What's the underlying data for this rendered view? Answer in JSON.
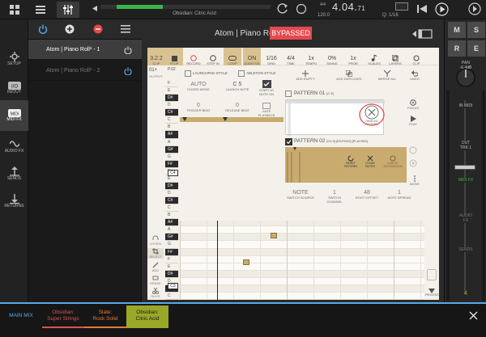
{
  "transport": {
    "track_name": "Obsidian: Citric Acid",
    "position": "4.04.",
    "position_ticks": "71",
    "time_sig": "4/4",
    "tempo": "120.0",
    "quantize": "Q: 1/16",
    "meter_level": 0.3
  },
  "sidebar": {
    "items": [
      {
        "label": "SETUP"
      },
      {
        "label": "IN/OUT"
      },
      {
        "label": "MIDI FX"
      },
      {
        "label": "AUDIO FX"
      },
      {
        "label": "SENDS"
      },
      {
        "label": "RETURNS"
      }
    ]
  },
  "fx": {
    "slots": [
      {
        "label": "Atom | Piano Roll² - 1"
      },
      {
        "label": "Atom | Piano Roll² - 2"
      }
    ]
  },
  "plugin": {
    "title": "Atom | Piano Roll²",
    "bypassed_label": "BYPASSED",
    "toolbar": {
      "clip_value": "3.2.2",
      "clip_label": "CLIP",
      "stop": "STOP",
      "record": "RECORD",
      "step_in": "STEP IN",
      "loop": "LOOP",
      "quantize_value": "ON",
      "quantize": "QUANTIZE",
      "grid_value": "1/16",
      "grid": "GRID",
      "timesig_value": "4/4",
      "timesig": "TIME",
      "tempo_value": "1x",
      "tempo": "TEMPO",
      "swing_value": "0%",
      "swing": "SWING",
      "prob_value": "1x",
      "prob": "PROB",
      "scales": "SCALES",
      "layers": "LAYERS",
      "clip": "CLIP"
    },
    "output_value": "01+",
    "output_label": "OUTPUT",
    "ruler_mark": "P.02",
    "launchpad_style": "LAUNCHPAD STYLE",
    "ableton_style": "ABLETON STYLE",
    "chord_mode_value": "AUTO",
    "chord_mode": "CHORD MODE",
    "launch_note_value": "C 5",
    "launch_note": "LAUNCH NOTE",
    "start_note_on": "START AT NOTE ON",
    "trigger_beat_value": "0",
    "trigger_beat": "TRIGGER BEAT",
    "release_beat_value": "0",
    "release_beat": "RELEASE BEAT",
    "gate_playback": "GATE PLAYBACK",
    "add_empty": "ADD EMPTY",
    "add_duplicate": "ADD DUPLICATE",
    "merge_all": "MERGE ALL",
    "undo": "UNDO",
    "pattern1": "PATTERN 01",
    "pattern1_note": "[C 5]",
    "pattern2": "PATTERN 02",
    "pattern2_note": "[C# 5] [EDITING] [PLAYING]",
    "remove_pattern": "REMOVE PATTERN",
    "reset_pattern": "RESET PATTERN",
    "clear_notes": "CLEAR NOTES",
    "cancel_automation": "CANCEL AUTOMATION",
    "focus": "FOCUS",
    "play": "PLAY",
    "move": "MOVE",
    "note_switch_value": "NOTE",
    "switch_source": "SWITCH SOURCE",
    "switch_channel_value": "1",
    "switch_channel": "SWITCH CHANNEL",
    "root_offset_value": "48",
    "root_offset": "ROOT OFFSET",
    "note_spread_value": "1",
    "note_spread": "NOTE SPREAD",
    "listen": "LISTEN",
    "select": "SELECT",
    "add": "ADD",
    "erase": "ERASE",
    "slice": "SLICE",
    "process": "PROCESS",
    "keys": [
      "F",
      "E",
      "D#",
      "D",
      "C#",
      "C",
      "B",
      "A#",
      "A",
      "G#",
      "G",
      "F#",
      "F",
      "E",
      "D#",
      "D",
      "C#",
      "C",
      "B",
      "A#",
      "A",
      "G#",
      "G",
      "F#",
      "F",
      "E",
      "D#",
      "D",
      "C#",
      "C"
    ],
    "key_tags": {
      "c4": "C4",
      "c3": "C3"
    }
  },
  "mixer": {
    "m": "M",
    "s": "S",
    "r": "R",
    "e": "E",
    "pan": "PAN",
    "db": "-6.4dB",
    "in_midi": "IN MIDI",
    "out_trk": "OUT TRK 1",
    "midi_fx": "MIDI FX",
    "audio_fx": "AUDIO FX",
    "sends": "SENDS",
    "page": "4",
    "fader_value": 0.33
  },
  "bottom": {
    "main_mix": "MAIN MIX",
    "tabs": [
      {
        "line1": "Obsidian:",
        "line2": "Super Strings",
        "color": "#d9534f"
      },
      {
        "line1": "Slate:",
        "line2": "Rock Solid",
        "color": "#e07b3a"
      },
      {
        "line1": "Obsidian:",
        "line2": "Citric Acid",
        "color": "#9aa828"
      }
    ]
  }
}
